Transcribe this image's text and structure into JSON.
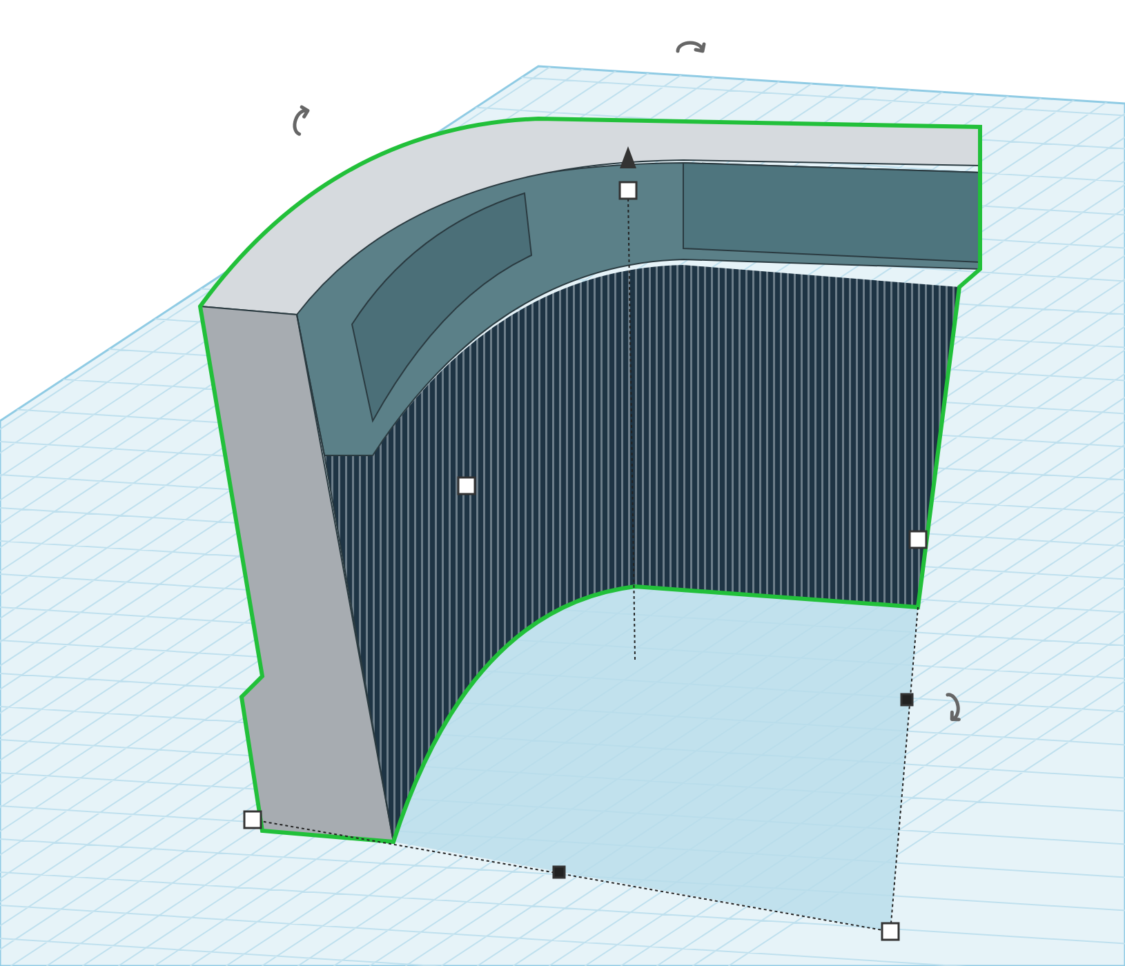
{
  "shape": {
    "selected": true
  }
}
